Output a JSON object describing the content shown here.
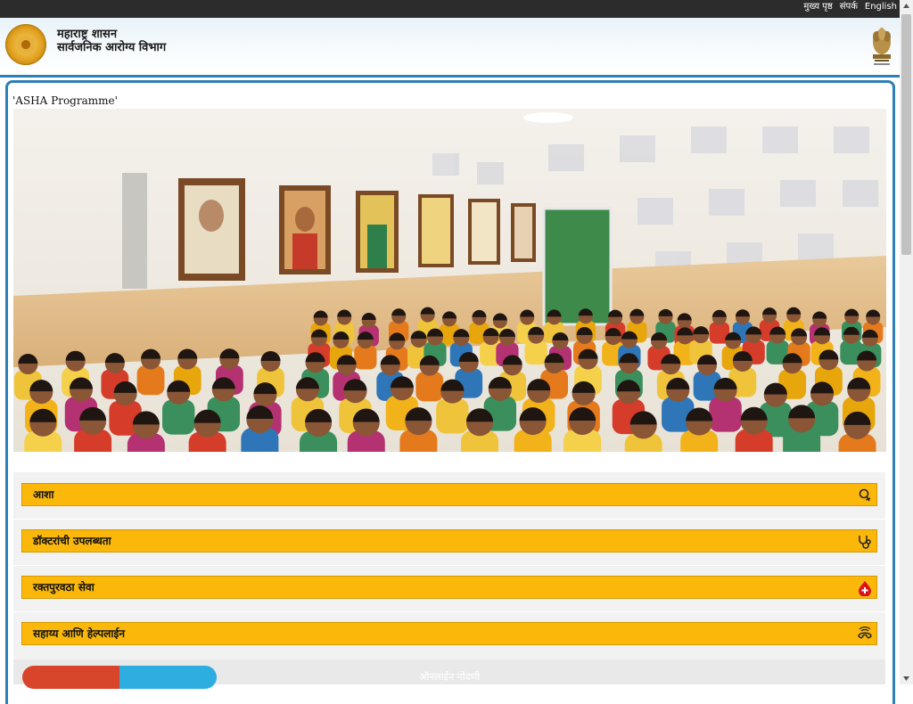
{
  "topbar": {
    "links": [
      "मुख्य पृष्ठ",
      "संपर्क",
      "English"
    ]
  },
  "header": {
    "line1": "महाराष्ट्र शासन",
    "line2": "सार्वजनिक आरोग्य विभाग"
  },
  "breadcrumb": "'ASHA Programme'",
  "services": [
    {
      "label": "आशा",
      "icon": "female-symbol-icon"
    },
    {
      "label": "डॉक्टरांची उपलब्धता",
      "icon": "stethoscope-icon"
    },
    {
      "label": "रक्तपुरवठा सेवा",
      "icon": "blood-drop-icon"
    },
    {
      "label": "सहाय्य आणि हेल्पलाईन",
      "icon": "phone-handset-icon"
    }
  ],
  "bottom": {
    "caption": "ऑनलाईन नोंदणी"
  },
  "colors": {
    "accent": "#2d7fb8",
    "service_bar": "#fbb80a",
    "topbar": "#2c2c2c"
  }
}
